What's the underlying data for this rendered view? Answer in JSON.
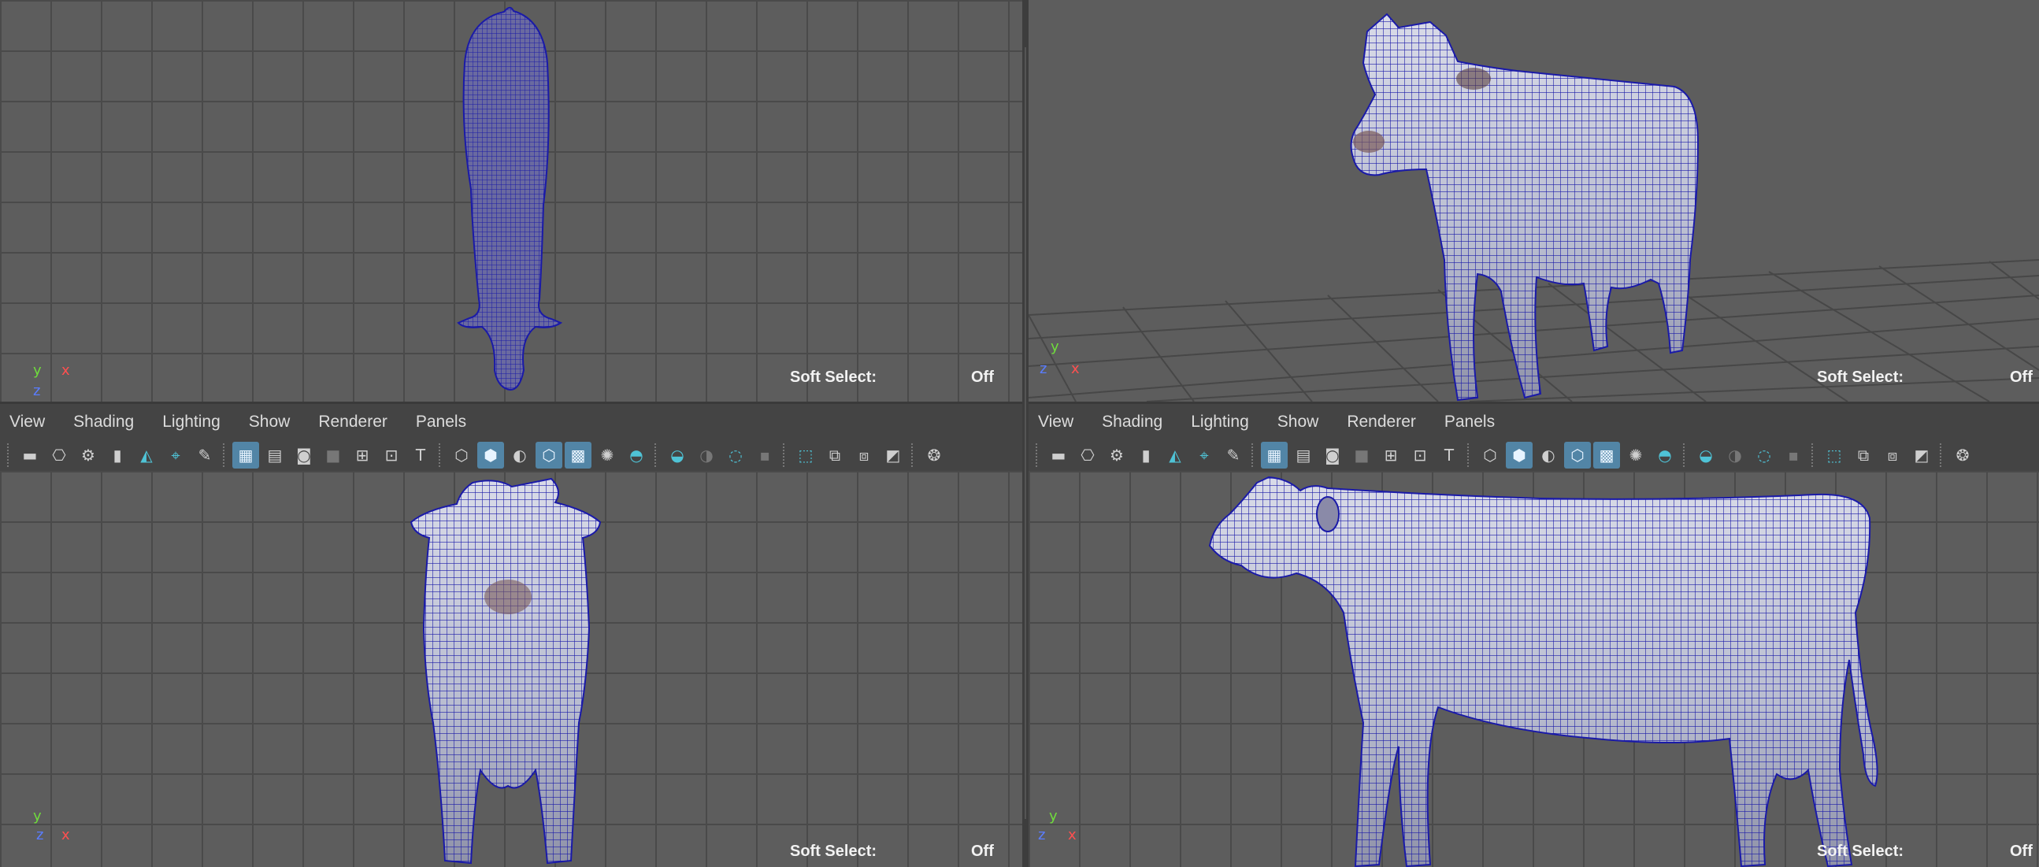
{
  "panel_menu": [
    "View",
    "Shading",
    "Lighting",
    "Show",
    "Renderer",
    "Panels"
  ],
  "soft_select": {
    "label": "Soft Select:",
    "value": "Off"
  },
  "axis_labels": {
    "x": "x",
    "y": "y",
    "z": "z"
  },
  "toolbar_icons": [
    "camera-icon",
    "camera-lock-icon",
    "camera-attributes-icon",
    "bookmark-icon",
    "image-plane-icon",
    "sep",
    "2d-pan-zoom-icon",
    "grease-pencil-icon",
    "sep",
    "grid-icon",
    "film-gate-icon",
    "resolution-gate-icon",
    "gate-mask-icon",
    "field-chart-icon",
    "safe-action-icon",
    "safe-title-icon",
    "sep",
    "wireframe-icon",
    "smooth-shade-icon",
    "default-lighting-icon",
    "wireframe-on-shaded-icon",
    "textured-icon",
    "use-lights-icon",
    "shadows-icon",
    "sep",
    "screen-space-ao-icon",
    "motion-blur-icon",
    "anti-aliasing-icon",
    "depth-of-field-icon",
    "sep",
    "isolate-select-icon",
    "xray-icon",
    "xray-joints-icon",
    "xray-components-icon",
    "backface-icon",
    "sep",
    "gamma-icon"
  ],
  "colors": {
    "viewport_bg": "#5d5d5d",
    "grid_line": "#4a4a4a",
    "wireframe": "#1a1aa8",
    "active_button": "#5285a6",
    "accent_teal": "#4fc3d6",
    "axis_x": "#ff5050",
    "axis_y": "#6fdc3c",
    "axis_z": "#5a7dff"
  }
}
